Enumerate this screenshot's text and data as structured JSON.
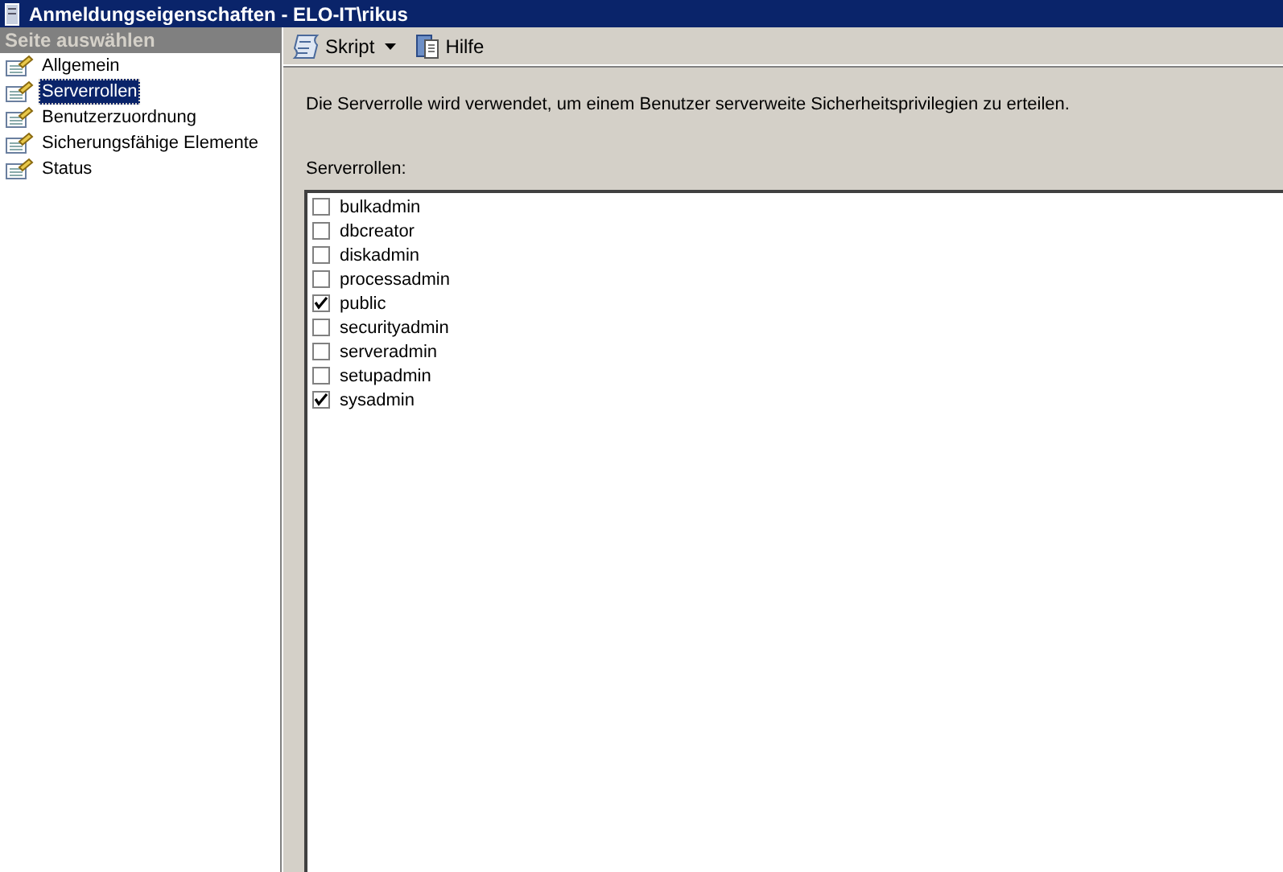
{
  "window": {
    "title": "Anmeldungseigenschaften - ELO-IT\\rikus"
  },
  "sidebar": {
    "header": "Seite auswählen",
    "items": [
      {
        "label": "Allgemein",
        "selected": false
      },
      {
        "label": "Serverrollen",
        "selected": true
      },
      {
        "label": "Benutzerzuordnung",
        "selected": false
      },
      {
        "label": "Sicherungsfähige Elemente",
        "selected": false
      },
      {
        "label": "Status",
        "selected": false
      }
    ]
  },
  "toolbar": {
    "script": "Skript",
    "help": "Hilfe"
  },
  "description": "Die Serverrolle wird verwendet, um einem Benutzer serverweite Sicherheitsprivilegien zu erteilen.",
  "roles_label": "Serverrollen:",
  "roles": [
    {
      "name": "bulkadmin",
      "checked": false
    },
    {
      "name": "dbcreator",
      "checked": false
    },
    {
      "name": "diskadmin",
      "checked": false
    },
    {
      "name": "processadmin",
      "checked": false
    },
    {
      "name": "public",
      "checked": true
    },
    {
      "name": "securityadmin",
      "checked": false
    },
    {
      "name": "serveradmin",
      "checked": false
    },
    {
      "name": "setupadmin",
      "checked": false
    },
    {
      "name": "sysadmin",
      "checked": true
    }
  ]
}
